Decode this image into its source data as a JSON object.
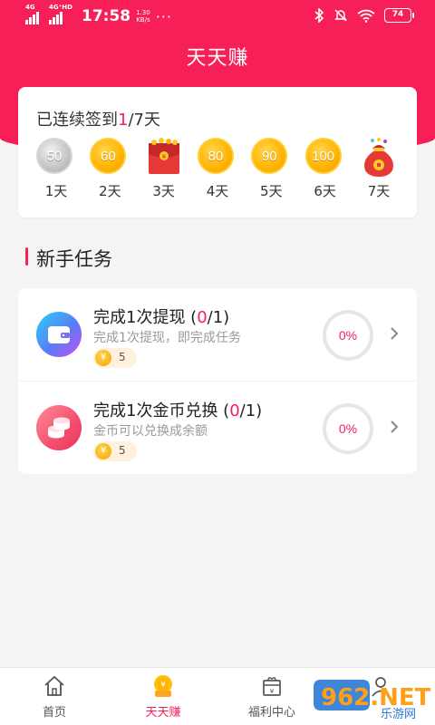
{
  "status_bar": {
    "network_1": "4G",
    "network_2": "4G⁺HD",
    "time": "17:58",
    "speed_value": "1.30",
    "speed_unit": "KB/s",
    "more": "···",
    "battery": "74"
  },
  "header": {
    "title": "天天赚"
  },
  "checkin": {
    "prefix": "已连续签到",
    "current": "1",
    "suffix": "/7天",
    "days": [
      {
        "value": "50",
        "label": "1天",
        "icon": "silver-coin-icon"
      },
      {
        "value": "60",
        "label": "2天",
        "icon": "gold-coin-icon"
      },
      {
        "value": "",
        "label": "3天",
        "icon": "red-envelope-icon"
      },
      {
        "value": "80",
        "label": "4天",
        "icon": "gold-coin-icon"
      },
      {
        "value": "90",
        "label": "5天",
        "icon": "gold-coin-icon"
      },
      {
        "value": "100",
        "label": "6天",
        "icon": "gold-coin-icon"
      },
      {
        "value": "",
        "label": "7天",
        "icon": "lucky-bag-icon"
      }
    ]
  },
  "newbie_tasks": {
    "section_title": "新手任务",
    "tasks": [
      {
        "name": "完成1次提现",
        "progress_open": " (",
        "progress_done": "0",
        "progress_total": "/1)",
        "desc": "完成1次提现，即完成任务",
        "reward_symbol": "¥",
        "reward": "5",
        "percent": "0%",
        "icon": "wallet-icon"
      },
      {
        "name": "完成1次金币兑换",
        "progress_open": " (",
        "progress_done": "0",
        "progress_total": "/1)",
        "desc": "金币可以兑换成余额",
        "reward_symbol": "¥",
        "reward": "5",
        "percent": "0%",
        "icon": "coin-stack-icon"
      }
    ]
  },
  "tabbar": {
    "tabs": [
      {
        "label": "首页",
        "icon": "home-icon"
      },
      {
        "label": "天天赚",
        "icon": "coin-purse-icon",
        "active": true
      },
      {
        "label": "福利中心",
        "icon": "gift-box-icon"
      },
      {
        "label": "",
        "icon": "profile-icon"
      }
    ]
  },
  "watermark": {
    "brand": "962.NET",
    "sub": "乐游网"
  },
  "colors": {
    "accent": "#f71f57",
    "gold": "#ffb300",
    "silver": "#c4c4c4"
  }
}
